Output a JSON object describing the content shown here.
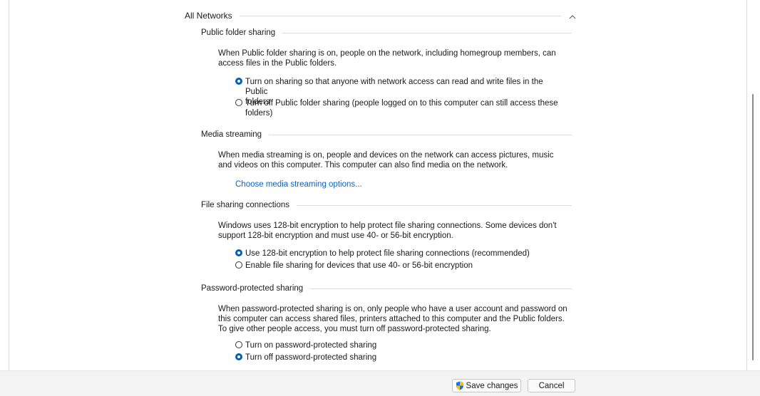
{
  "group": {
    "title": "All Networks",
    "collapse_glyph": "^"
  },
  "sections": {
    "public_folder": {
      "title": "Public folder sharing",
      "description": "When Public folder sharing is on, people on the network, including homegroup members, can access files in the Public folders.",
      "options": [
        {
          "label_line1": "Turn on sharing so that anyone with network access can read and write files in the Public",
          "label_line2": "folders",
          "checked": true
        },
        {
          "label_line1": "Turn off Public folder sharing (people logged on to this computer can still access these",
          "label_line2": "folders)",
          "checked": false
        }
      ]
    },
    "media_streaming": {
      "title": "Media streaming",
      "description": "When media streaming is on, people and devices on the network can access pictures, music and videos on this computer. This computer can also find media on the network.",
      "link": "Choose media streaming options..."
    },
    "file_sharing": {
      "title": "File sharing connections",
      "description": "Windows uses 128-bit encryption to help protect file sharing connections. Some devices don't support 128-bit encryption and must use 40- or 56-bit encryption.",
      "options": [
        {
          "label": "Use 128-bit encryption to help protect file sharing connections (recommended)",
          "checked": true
        },
        {
          "label": "Enable file sharing for devices that use 40- or 56-bit encryption",
          "checked": false
        }
      ]
    },
    "password_protected": {
      "title": "Password-protected sharing",
      "description": "When password-protected sharing is on, only people who have a user account and password on this computer can access shared files, printers attached to this computer and the Public folders. To give other people access, you must turn off password-protected sharing.",
      "options": [
        {
          "label": "Turn on password-protected sharing",
          "checked": false
        },
        {
          "label": "Turn off password-protected sharing",
          "checked": true
        }
      ]
    }
  },
  "footer": {
    "save_label": "Save changes",
    "cancel_label": "Cancel"
  },
  "colors": {
    "accent": "#005fb8",
    "link": "#0b62c4",
    "footer_bg": "#f3f3f3",
    "shield_blue": "#1e74d2",
    "shield_yellow": "#f4c01e"
  },
  "icons": {
    "shield": "uac-shield-icon",
    "chevron": "chevron-up-icon"
  }
}
